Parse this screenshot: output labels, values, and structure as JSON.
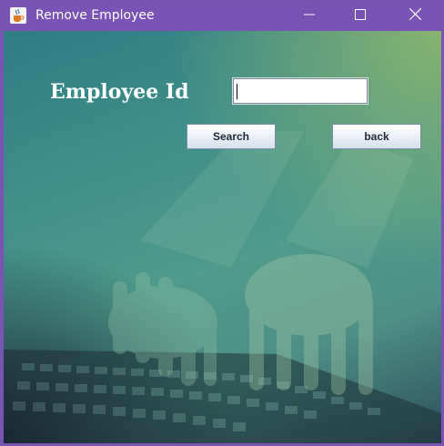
{
  "window": {
    "title": "Remove Employee",
    "app_icon": "java-cup-icon",
    "controls": [
      "minimize-icon",
      "maximize-icon",
      "close-icon"
    ]
  },
  "form": {
    "employee_id_label": "Employee Id",
    "employee_id_value": "",
    "search_label": "Search",
    "back_label": "back"
  },
  "colors": {
    "titlebar": "#7b52b5",
    "background_teal": "#3f8f8a",
    "background_green": "#88b371",
    "button_text": "#1e2a3a"
  }
}
